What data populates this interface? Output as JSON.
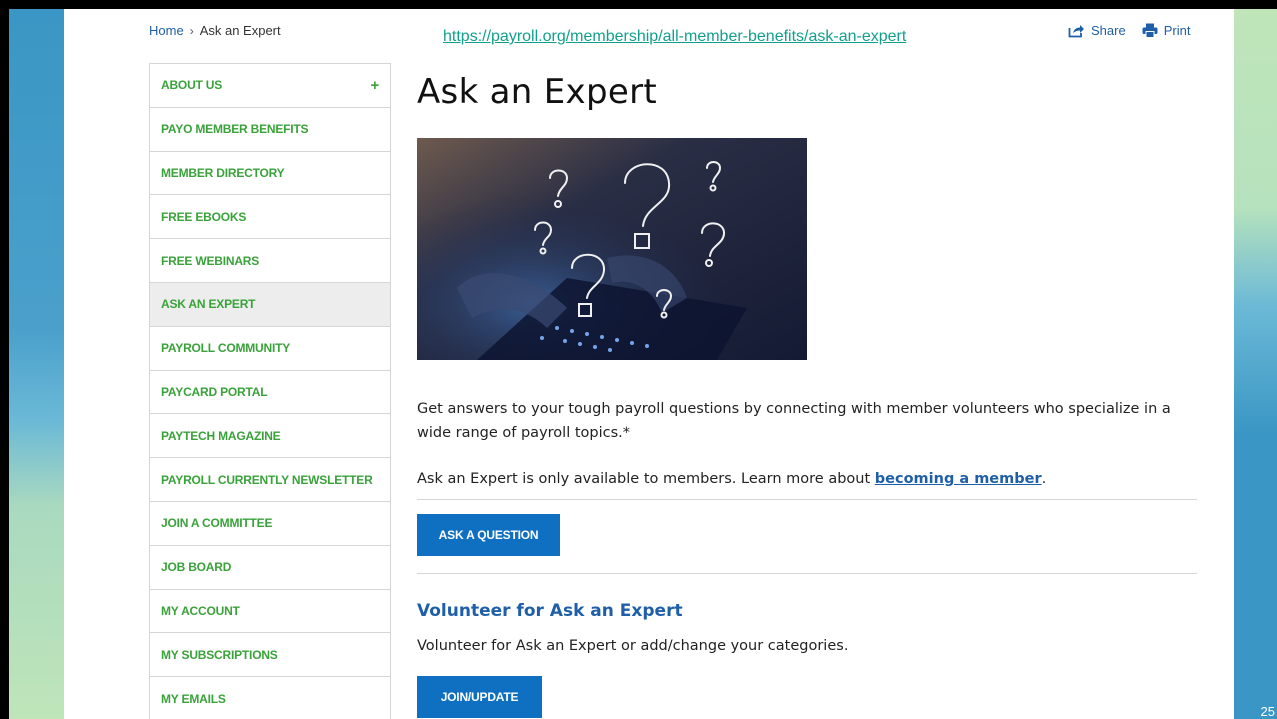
{
  "breadcrumb": {
    "home": "Home",
    "separator": "›",
    "current": "Ask an Expert"
  },
  "url": "https://payroll.org/membership/all-member-benefits/ask-an-expert",
  "actions": {
    "share": "Share",
    "print": "Print",
    "share_icon": "share-icon",
    "print_icon": "printer-icon"
  },
  "sidenav": {
    "items": [
      {
        "label": "ABOUT US",
        "expand": "+"
      },
      {
        "label": "PAYO MEMBER BENEFITS"
      },
      {
        "label": "MEMBER DIRECTORY"
      },
      {
        "label": "FREE EBOOKS"
      },
      {
        "label": "FREE WEBINARS"
      },
      {
        "label": "ASK AN EXPERT",
        "active": true
      },
      {
        "label": "PAYROLL COMMUNITY"
      },
      {
        "label": "PAYCARD PORTAL"
      },
      {
        "label": "PAYTECH MAGAZINE"
      },
      {
        "label": "PAYROLL CURRENTLY NEWSLETTER"
      },
      {
        "label": "JOIN A COMMITTEE"
      },
      {
        "label": "JOB BOARD"
      },
      {
        "label": "MY ACCOUNT"
      },
      {
        "label": "MY SUBSCRIPTIONS"
      },
      {
        "label": "MY EMAILS"
      }
    ]
  },
  "main": {
    "title": "Ask an Expert",
    "intro": "Get answers to your tough payroll questions by connecting with member volunteers who specialize in a wide range of payroll topics.*",
    "members_only": "Ask an Expert is only available to members. Learn more about",
    "member_link": "becoming a member",
    "members_only_end": ".",
    "ask_button": "ASK A QUESTION",
    "volunteer_heading": "Volunteer for Ask an Expert",
    "volunteer_text": "Volunteer for Ask an Expert or add/change your categories.",
    "join_button": "JOIN/UPDATE"
  },
  "slide": {
    "page_number": "25"
  },
  "colors": {
    "nav_green": "#3aa23a",
    "link_blue": "#1f5fa8",
    "button_blue": "#0f6fc0",
    "url_teal": "#12a08c"
  }
}
